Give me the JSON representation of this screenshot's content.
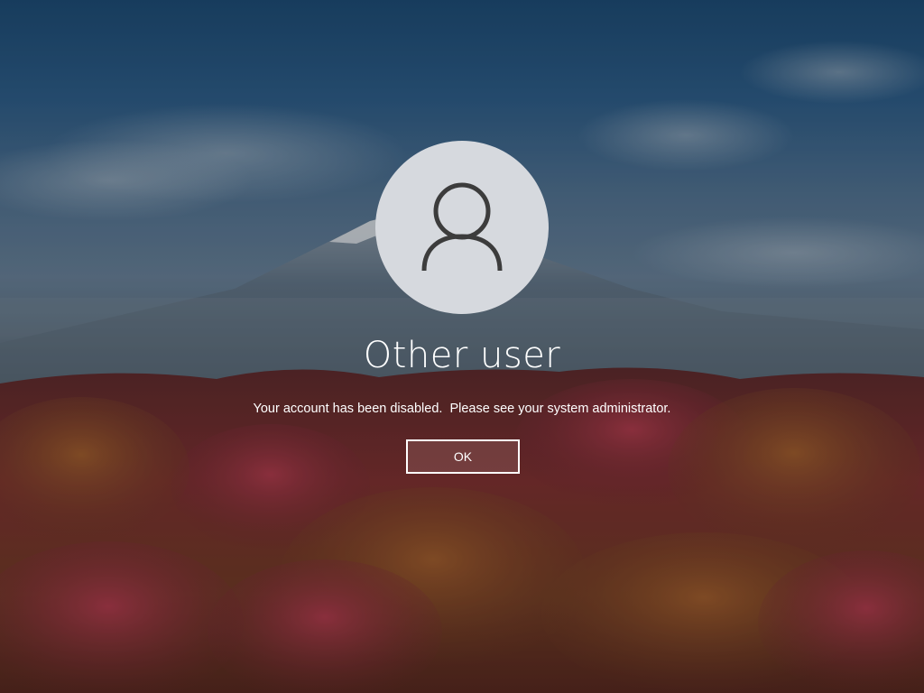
{
  "lock_screen": {
    "user": {
      "avatar_icon": "person-icon",
      "display_name": "Other user"
    },
    "message": "Your account has been disabled.  Please see your system administrator.",
    "ok_button_label": "OK",
    "colors": {
      "sky_top": "#1d4a72",
      "mountain": "#5d6f80",
      "field": "#6d2c30",
      "avatar_background": "#d6d9de",
      "avatar_glyph": "#3c3c3c",
      "text": "#ffffff"
    }
  }
}
